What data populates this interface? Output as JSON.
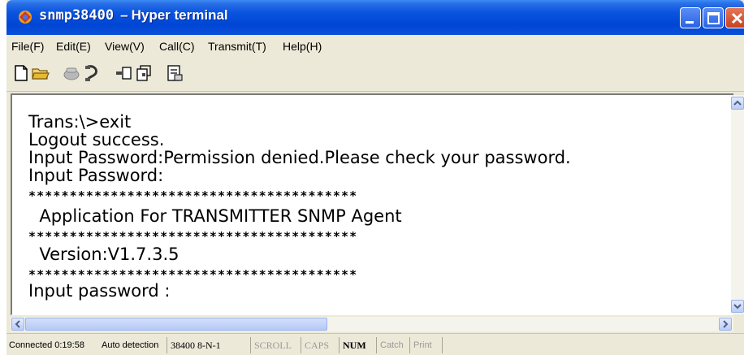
{
  "window": {
    "title_name": "snmp38400",
    "title_separator": "–",
    "title_app": "Hyper terminal"
  },
  "menu": [
    "File(F)",
    "Edit(E)",
    "View(V)",
    "Call(C)",
    "Transmit(T)",
    "Help(H)"
  ],
  "toolbar": {
    "icons": [
      "new-document-icon",
      "open-folder-icon",
      "connect-phone-icon",
      "disconnect-phone-icon",
      "send-file-icon",
      "receive-file-icon",
      "properties-icon"
    ]
  },
  "terminal": {
    "lines": [
      "Trans:\\>exit",
      "Logout success.",
      "Input Password:Permission denied.Please check your password.",
      "Input Password:",
      "****************************************",
      "  Application For TRANSMITTER SNMP Agent",
      "****************************************",
      "  Version:V1.7.3.5",
      "****************************************",
      "Input password :"
    ]
  },
  "status": {
    "connected": "Connected 0:19:58",
    "detection": "Auto detection",
    "port": "38400 8-N-1",
    "scroll": "SCROLL",
    "caps": "CAPS",
    "num": "NUM",
    "catch": "Catch",
    "print": "Print"
  },
  "colors": {
    "titlebar": "#0a55e0",
    "close_button": "#c8421f",
    "window_bg": "#ece9d8",
    "terminal_bg": "#ffffff"
  }
}
